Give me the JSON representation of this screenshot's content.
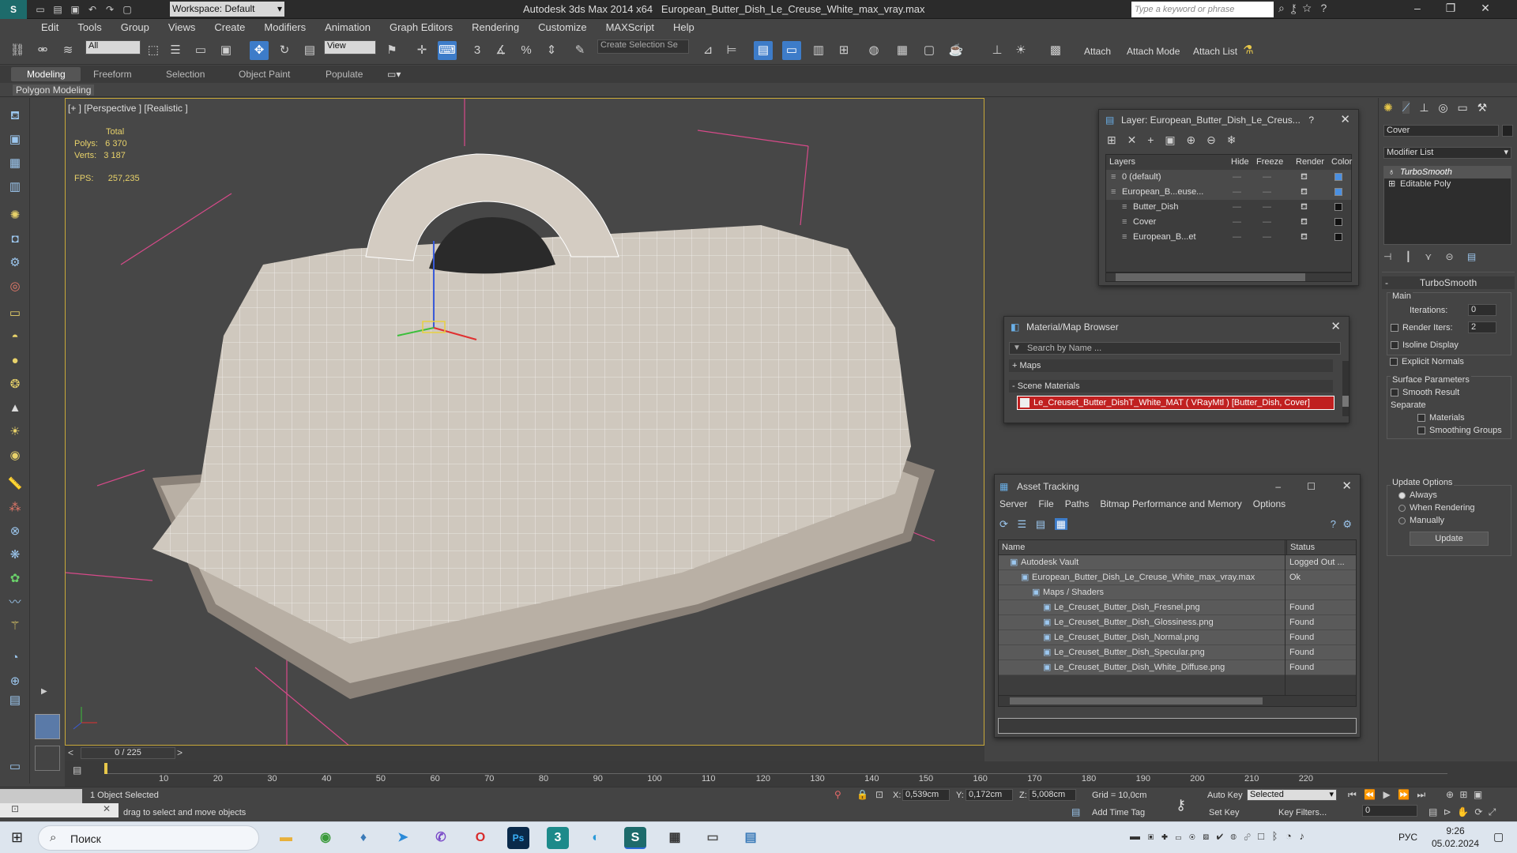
{
  "titlebar": {
    "workspace": "Workspace: Default",
    "app": "Autodesk 3ds Max  2014 x64",
    "file": "European_Butter_Dish_Le_Creuse_White_max_vray.max",
    "search_placeholder": "Type a keyword or phrase"
  },
  "menu": [
    "Edit",
    "Tools",
    "Group",
    "Views",
    "Create",
    "Modifiers",
    "Animation",
    "Graph Editors",
    "Rendering",
    "Customize",
    "MAXScript",
    "Help"
  ],
  "toolbar": {
    "filter": "All",
    "refcoord": "View",
    "selection_set": "Create Selection Se",
    "attach": "Attach",
    "attach_mode": "Attach Mode",
    "attach_list": "Attach List"
  },
  "ribbon": {
    "tabs": [
      "Modeling",
      "Freeform",
      "Selection",
      "Object Paint",
      "Populate"
    ],
    "sub": "Polygon Modeling"
  },
  "viewport": {
    "label": "[+ ] [Perspective ] [Realistic ]",
    "stats": {
      "total_label": "Total",
      "polys_label": "Polys:",
      "polys": "6 370",
      "verts_label": "Verts:",
      "verts": "3 187",
      "fps_label": "FPS:",
      "fps": "257,235"
    }
  },
  "layer_win": {
    "title": "Layer: European_Butter_Dish_Le_Creus...",
    "help": "?",
    "cols": [
      "Layers",
      "Hide",
      "Freeze",
      "Render",
      "Color"
    ],
    "rows": [
      {
        "name": "0 (default)",
        "color": "#4a90e2"
      },
      {
        "name": "European_B...euse...",
        "color": "#4a90e2"
      },
      {
        "name": "Butter_Dish",
        "color": "#111111"
      },
      {
        "name": "Cover",
        "color": "#111111"
      },
      {
        "name": "European_B...et",
        "color": "#111111"
      }
    ]
  },
  "mat_win": {
    "title": "Material/Map Browser",
    "search_placeholder": "Search by Name ...",
    "maps": "+ Maps",
    "scene": "- Scene Materials",
    "material": "Le_Creuset_Butter_DishT_White_MAT ( VRayMtl ) [Butter_Dish, Cover]"
  },
  "asset_win": {
    "title": "Asset Tracking",
    "menu": [
      "Server",
      "File",
      "Paths",
      "Bitmap Performance and Memory",
      "Options"
    ],
    "cols": [
      "Name",
      "Status"
    ],
    "rows": [
      {
        "name": "Autodesk Vault",
        "status": "Logged Out ...",
        "indent": 1
      },
      {
        "name": "European_Butter_Dish_Le_Creuse_White_max_vray.max",
        "status": "Ok",
        "indent": 2
      },
      {
        "name": "Maps / Shaders",
        "status": "",
        "indent": 3
      },
      {
        "name": "Le_Creuset_Butter_Dish_Fresnel.png",
        "status": "Found",
        "indent": 4
      },
      {
        "name": "Le_Creuset_Butter_Dish_Glossiness.png",
        "status": "Found",
        "indent": 4
      },
      {
        "name": "Le_Creuset_Butter_Dish_Normal.png",
        "status": "Found",
        "indent": 4
      },
      {
        "name": "Le_Creuset_Butter_Dish_Specular.png",
        "status": "Found",
        "indent": 4
      },
      {
        "name": "Le_Creuset_Butter_Dish_White_Diffuse.png",
        "status": "Found",
        "indent": 4
      }
    ]
  },
  "command_panel": {
    "object_name": "Cover",
    "modifier_list": "Modifier List",
    "stack": [
      "TurboSmooth",
      "Editable Poly"
    ],
    "rollout": "TurboSmooth",
    "main": "Main",
    "iterations_label": "Iterations:",
    "iterations": "0",
    "render_iters_label": "Render Iters:",
    "render_iters": "2",
    "isoline": "Isoline Display",
    "explicit": "Explicit Normals",
    "surface": "Surface Parameters",
    "smooth_result": "Smooth Result",
    "separate": "Separate",
    "materials": "Materials",
    "smoothing_groups": "Smoothing Groups",
    "update_options": "Update Options",
    "always": "Always",
    "when_rendering": "When Rendering",
    "manually": "Manually",
    "update": "Update"
  },
  "timeline": {
    "frame": "0 / 225",
    "ticks": [
      "10",
      "20",
      "30",
      "40",
      "50",
      "60",
      "70",
      "80",
      "90",
      "100",
      "110",
      "120",
      "130",
      "140",
      "150",
      "160",
      "170",
      "180",
      "190",
      "200",
      "210",
      "220"
    ]
  },
  "status": {
    "selected": "1 Object Selected",
    "prompt": "drag to select and move objects",
    "x_label": "X:",
    "x": "0,539cm",
    "y_label": "Y:",
    "y": "0,172cm",
    "z_label": "Z:",
    "z": "5,008cm",
    "grid": "Grid = 10,0cm",
    "auto_key": "Auto Key",
    "selected_mode": "Selected",
    "set_key": "Set Key",
    "key_filters": "Key Filters...",
    "add_time_tag": "Add Time Tag",
    "frame_field": "0"
  },
  "taskbar": {
    "search": "Поиск",
    "lang": "РУС",
    "time": "9:26",
    "date": "05.02.2024"
  }
}
